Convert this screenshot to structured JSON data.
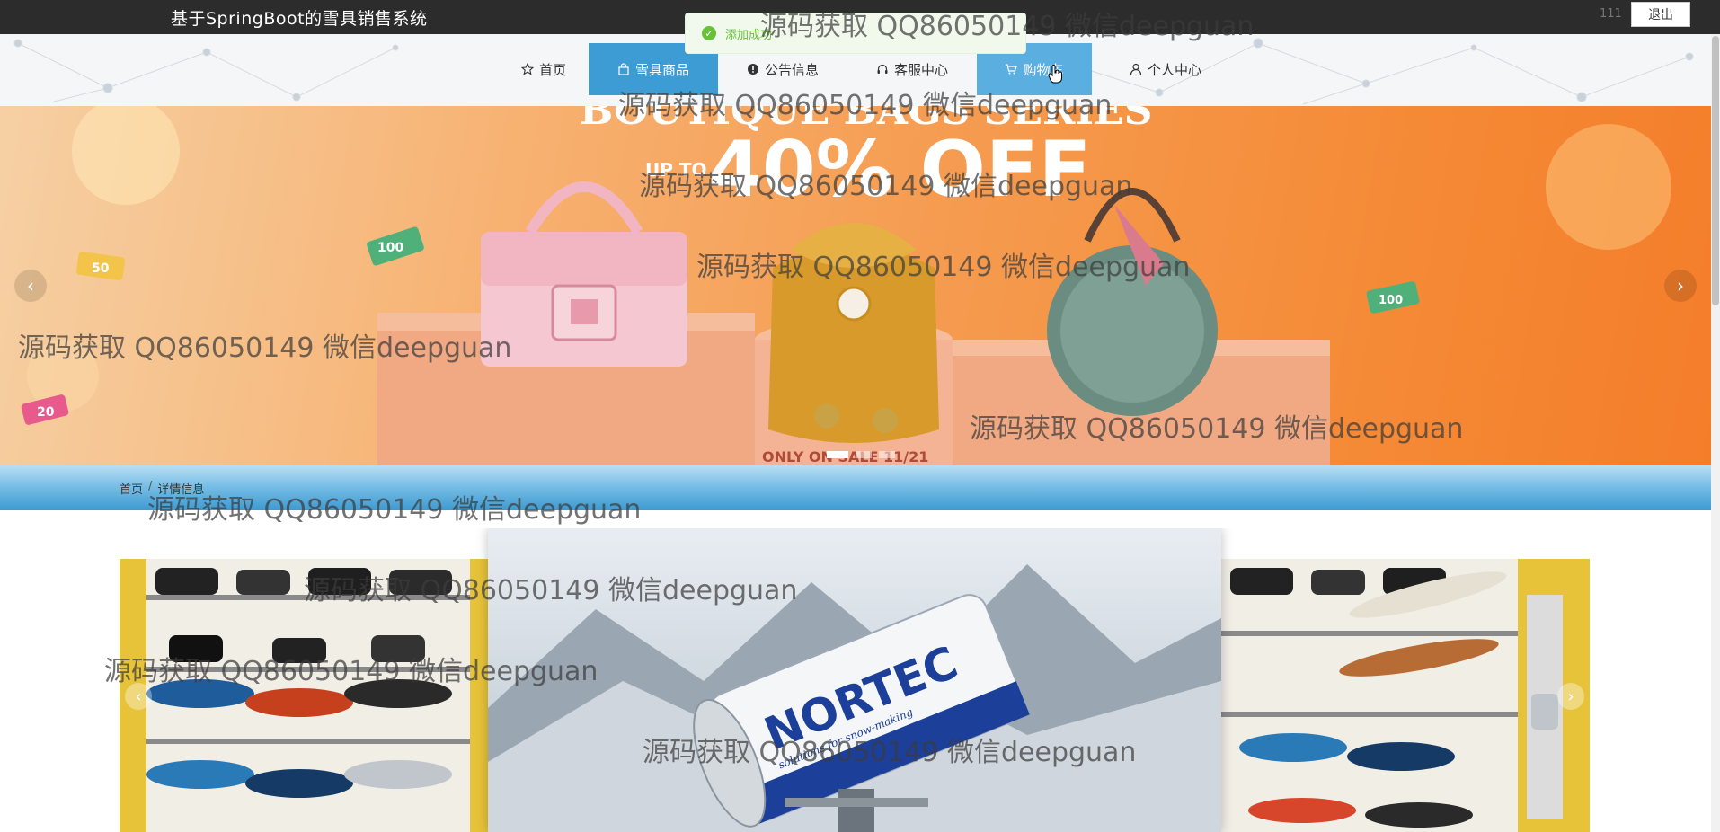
{
  "header": {
    "site_title": "基于SpringBoot的雪具销售系统",
    "user_name": "111",
    "logout_label": "退出"
  },
  "nav": {
    "items": [
      {
        "label": "首页",
        "icon": "star-icon",
        "state": "normal"
      },
      {
        "label": "雪具商品",
        "icon": "bag-icon",
        "state": "active"
      },
      {
        "label": "公告信息",
        "icon": "exclamation-icon",
        "state": "normal"
      },
      {
        "label": "客服中心",
        "icon": "headset-icon",
        "state": "normal"
      },
      {
        "label": "购物车",
        "icon": "cart-icon",
        "state": "hover"
      },
      {
        "label": "个人中心",
        "icon": "user-icon",
        "state": "normal"
      }
    ]
  },
  "toast": {
    "text": "添加成功",
    "type": "success",
    "color": "#67c23a"
  },
  "banner": {
    "headline_top": "BOUTIQUE BAGS SERIES",
    "up_to": "UP TO",
    "discount": "40% OFF",
    "date_text": "ONLY ON SALE 11/21",
    "badges": [
      "50",
      "100",
      "100",
      "20"
    ],
    "slide_count": 3,
    "active_slide": 1
  },
  "breadcrumb": {
    "home": "首页",
    "separator": "/",
    "current": "详情信息"
  },
  "gallery": {
    "center_brand": "NORTEC",
    "center_tagline": "solutions for snow-making"
  },
  "watermark": {
    "text": "源码获取 QQ86050149 微信deepguan"
  },
  "colors": {
    "topbar": "#2c2c2c",
    "nav_active": "#3e9cd5",
    "banner": "#f58a36"
  }
}
